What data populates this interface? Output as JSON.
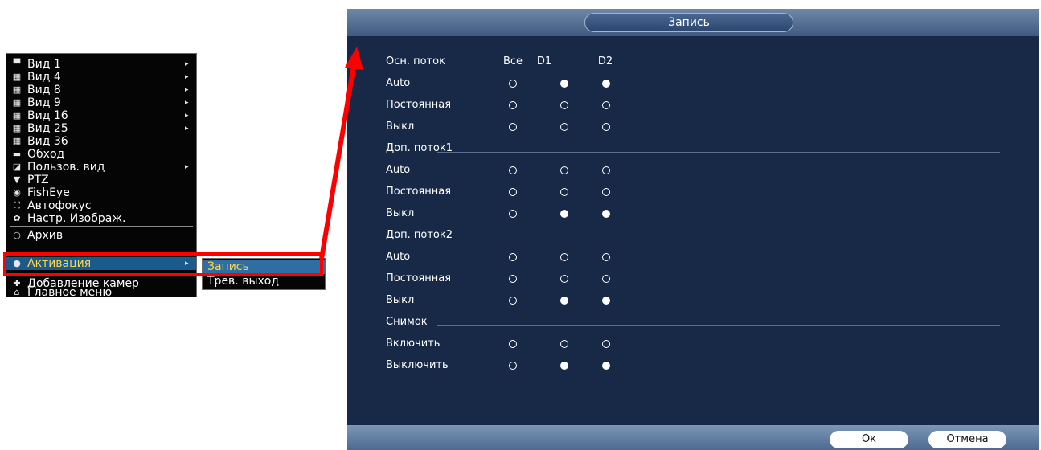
{
  "menu": {
    "items": [
      {
        "icon": "single-view-icon",
        "glyph": "▀",
        "label": "Вид 1",
        "arrow": "▸"
      },
      {
        "icon": "four-view-icon",
        "glyph": "▦",
        "label": "Вид 4",
        "arrow": "▸"
      },
      {
        "icon": "eight-view-icon",
        "glyph": "▦",
        "label": "Вид 8",
        "arrow": "▸"
      },
      {
        "icon": "nine-view-icon",
        "glyph": "▦",
        "label": "Вид 9",
        "arrow": "▸"
      },
      {
        "icon": "sixteen-view-icon",
        "glyph": "▦",
        "label": "Вид 16",
        "arrow": "▸"
      },
      {
        "icon": "twentyfive-view-icon",
        "glyph": "▦",
        "label": "Вид 25",
        "arrow": "▸"
      },
      {
        "icon": "thirtysix-view-icon",
        "glyph": "▦",
        "label": "Вид 36",
        "arrow": ""
      },
      {
        "icon": "tour-icon",
        "glyph": "▬",
        "label": "Обход",
        "arrow": ""
      },
      {
        "icon": "custom-view-icon",
        "glyph": "◪",
        "label": "Пользов. вид",
        "arrow": "▸"
      },
      {
        "icon": "ptz-icon",
        "glyph": "▼",
        "label": "PTZ",
        "arrow": ""
      },
      {
        "icon": "fisheye-icon",
        "glyph": "◉",
        "label": "FishEye",
        "arrow": ""
      },
      {
        "icon": "autofocus-icon",
        "glyph": "⛶",
        "label": "Автофокус",
        "arrow": ""
      },
      {
        "icon": "image-settings-icon",
        "glyph": "✿",
        "label": "Настр. Изображ.",
        "arrow": ""
      },
      {
        "icon": "archive-icon",
        "glyph": "○",
        "label": "Архив",
        "arrow": ""
      },
      {
        "icon": "activation-icon",
        "glyph": "●",
        "label": "Активация",
        "arrow": "▸"
      },
      {
        "icon": "add-camera-icon",
        "glyph": "✚",
        "label": "Добавление камер",
        "arrow": ""
      },
      {
        "icon": "main-menu-icon",
        "glyph": "⌂",
        "label": "Главное меню",
        "arrow": ""
      }
    ],
    "submenu": [
      {
        "label": "Запись"
      },
      {
        "label": "Трев. выход"
      }
    ]
  },
  "dialog": {
    "title": "Запись",
    "columns": [
      "Все",
      "D1",
      "D2"
    ],
    "sections": [
      {
        "title": "Осн. поток",
        "rows": [
          {
            "label": "Auto",
            "values": [
              false,
              true,
              true
            ]
          },
          {
            "label": "Постоянная",
            "values": [
              false,
              false,
              false
            ]
          },
          {
            "label": "Выкл",
            "values": [
              false,
              false,
              false
            ]
          }
        ]
      },
      {
        "title": "Доп. поток1",
        "rows": [
          {
            "label": "Auto",
            "values": [
              false,
              false,
              false
            ]
          },
          {
            "label": "Постоянная",
            "values": [
              false,
              false,
              false
            ]
          },
          {
            "label": "Выкл",
            "values": [
              false,
              true,
              true
            ]
          }
        ]
      },
      {
        "title": "Доп. поток2",
        "rows": [
          {
            "label": "Auto",
            "values": [
              false,
              false,
              false
            ]
          },
          {
            "label": "Постоянная",
            "values": [
              false,
              false,
              false
            ]
          },
          {
            "label": "Выкл",
            "values": [
              false,
              true,
              true
            ]
          }
        ]
      },
      {
        "title": "Снимок",
        "rows": [
          {
            "label": "Включить",
            "values": [
              false,
              false,
              false
            ]
          },
          {
            "label": "Выключить",
            "values": [
              false,
              true,
              true
            ]
          }
        ]
      }
    ],
    "ok_label": "Ок",
    "cancel_label": "Отмена"
  },
  "colors": {
    "highlight": "#ff0000",
    "accent_text": "#ffd84a",
    "dialog_bg": "#182947"
  }
}
